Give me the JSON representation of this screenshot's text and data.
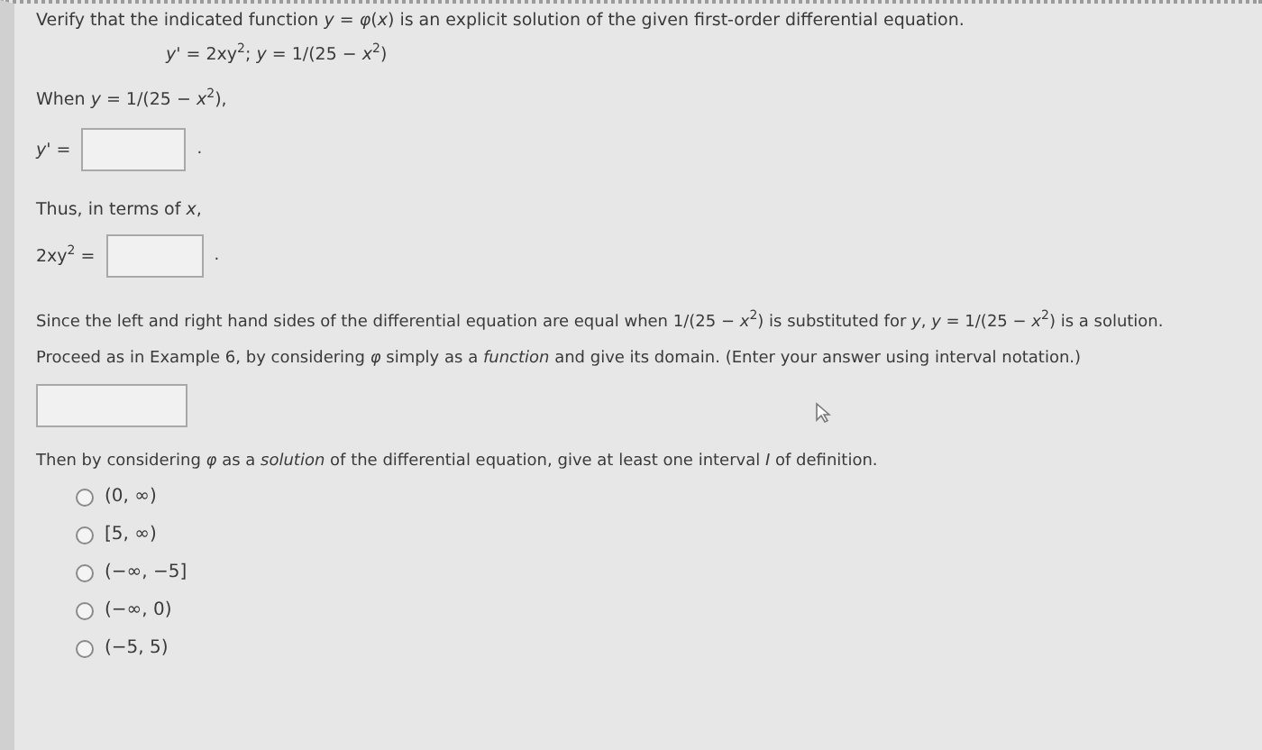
{
  "prompt": "Verify that the indicated function *y* = *φ*(*x*) is an explicit solution of the given first-order differential equation.",
  "equation": "*y*' = 2xy$^{2}$;   *y* = 1/(25 − *x*$^{2}$)",
  "when_text": "When *y* = 1/(25 − *x*$^{2}$),",
  "answer_1": {
    "label": "*y*' =",
    "after": "."
  },
  "thus_text": "Thus, in terms of *x*,",
  "answer_2": {
    "label": "2xy$^{2}$ =",
    "after": "."
  },
  "since_text": "Since the left and right hand sides of the differential equation are equal when 1/(25 − *x*$^{2}$) is substituted for *y*, *y* = 1/(25 − *x*$^{2}$) is a solution.",
  "proceed_text": "Proceed as in Example 6, by considering *φ* simply as a *function* and give its domain. (Enter your answer using interval notation.)",
  "then_text": "Then by considering *φ* as a *solution* of the differential equation, give at least one interval *I* of definition.",
  "options": [
    {
      "label": "(0, ∞)",
      "selected": false
    },
    {
      "label": "[5, ∞)",
      "selected": false
    },
    {
      "label": "(−∞, −5]",
      "selected": false
    },
    {
      "label": "(−∞, 0)",
      "selected": false
    },
    {
      "label": "(−5, 5)",
      "selected": false
    }
  ]
}
